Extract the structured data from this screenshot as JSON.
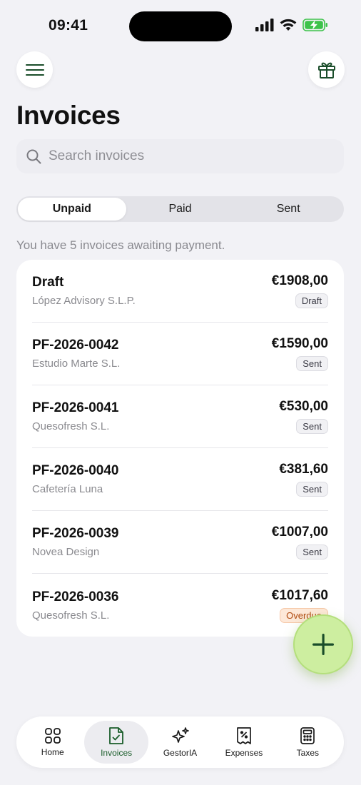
{
  "status_bar": {
    "time": "09:41"
  },
  "header": {
    "title": "Invoices"
  },
  "search": {
    "placeholder": "Search invoices"
  },
  "segments": [
    {
      "label": "Unpaid",
      "active": true
    },
    {
      "label": "Paid",
      "active": false
    },
    {
      "label": "Sent",
      "active": false
    }
  ],
  "summary": "You have 5 invoices awaiting payment.",
  "invoices": [
    {
      "number": "Draft",
      "client": "López Advisory S.L.P.",
      "amount": "€1908,00",
      "status": "Draft"
    },
    {
      "number": "PF-2026-0042",
      "client": "Estudio Marte S.L.",
      "amount": "€1590,00",
      "status": "Sent"
    },
    {
      "number": "PF-2026-0041",
      "client": "Quesofresh S.L.",
      "amount": "€530,00",
      "status": "Sent"
    },
    {
      "number": "PF-2026-0040",
      "client": "Cafetería Luna",
      "amount": "€381,60",
      "status": "Sent"
    },
    {
      "number": "PF-2026-0039",
      "client": "Novea Design",
      "amount": "€1007,00",
      "status": "Sent"
    },
    {
      "number": "PF-2026-0036",
      "client": "Quesofresh S.L.",
      "amount": "€1017,60",
      "status": "Overdue"
    }
  ],
  "tabs": [
    {
      "label": "Home",
      "icon": "grid-icon"
    },
    {
      "label": "Invoices",
      "icon": "document-check-icon",
      "active": true
    },
    {
      "label": "GestorIA",
      "icon": "sparkles-icon"
    },
    {
      "label": "Expenses",
      "icon": "receipt-icon"
    },
    {
      "label": "Taxes",
      "icon": "calculator-icon"
    }
  ],
  "colors": {
    "accent_green": "#1a5d2a",
    "fab_background": "#cdeea0",
    "battery_green": "#3cc24a",
    "overdue_text": "#b04a10",
    "overdue_background": "#fde8d8"
  }
}
